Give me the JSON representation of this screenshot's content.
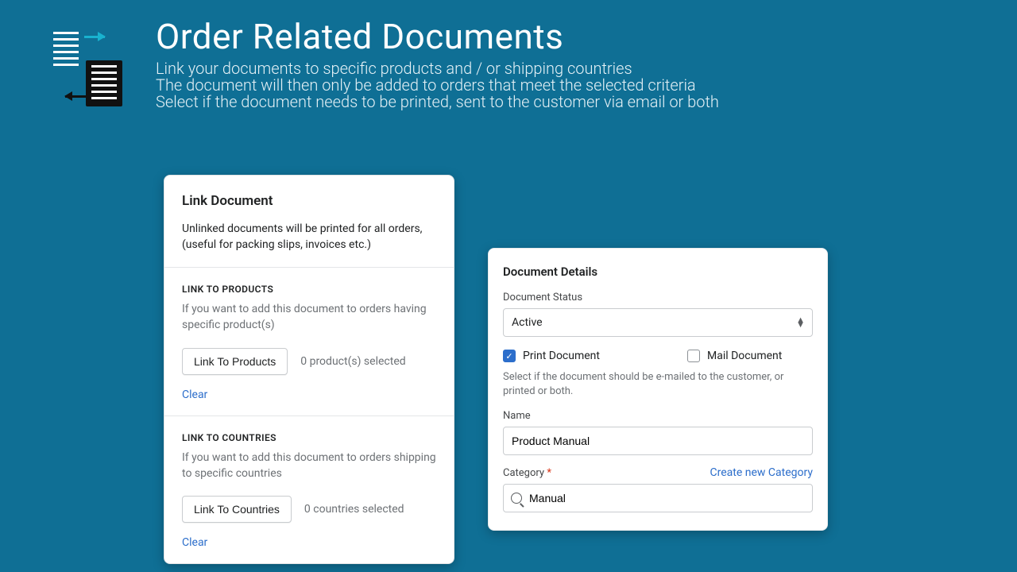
{
  "header": {
    "title": "Order Related Documents",
    "line1": "Link your documents to specific products and / or shipping countries",
    "line2": "The document will then only be added to orders that meet the selected criteria",
    "line3": "Select if the document needs to be printed, sent to the customer via email or both"
  },
  "link_card": {
    "title": "Link Document",
    "intro": "Unlinked documents will be printed for all orders, (useful for packing slips, invoices etc.)",
    "products": {
      "heading": "LINK TO PRODUCTS",
      "desc": "If you want to add this document to orders having specific product(s)",
      "button": "Link To Products",
      "count": "0 product(s) selected",
      "clear": "Clear"
    },
    "countries": {
      "heading": "LINK TO COUNTRIES",
      "desc": "If you want to add this document to orders shipping to specific countries",
      "button": "Link To Countries",
      "count": "0 countries selected",
      "clear": "Clear"
    }
  },
  "details_card": {
    "title": "Document Details",
    "status_label": "Document Status",
    "status_value": "Active",
    "print_label": "Print Document",
    "mail_label": "Mail Document",
    "hint": "Select if the document should be e-mailed to the customer, or printed or both.",
    "name_label": "Name",
    "name_value": "Product Manual",
    "category_label": "Category",
    "create_category": "Create new Category",
    "category_value": "Manual"
  }
}
